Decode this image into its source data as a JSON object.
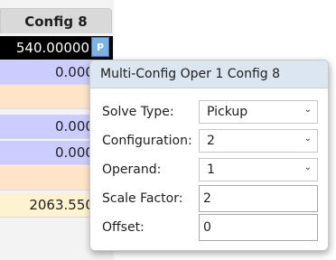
{
  "grid": {
    "column_header": "Config 8",
    "cells": [
      {
        "value": "540.00000",
        "style": "selected"
      },
      {
        "value": "0.00000",
        "style": "lav"
      },
      {
        "value": "",
        "style": "peach"
      },
      {
        "value": "0.00000",
        "style": "lav"
      },
      {
        "value": "0.00000",
        "style": "lav"
      },
      {
        "value": "",
        "style": "peach"
      },
      {
        "value": "2063.55000",
        "style": "yellow"
      }
    ],
    "p_button": "P"
  },
  "popup": {
    "title": "Multi-Config Oper 1 Config 8",
    "solve_type": {
      "label": "Solve Type:",
      "value": "Pickup"
    },
    "configuration": {
      "label": "Configuration:",
      "value": "2"
    },
    "operand": {
      "label": "Operand:",
      "value": "1"
    },
    "scale_factor": {
      "label": "Scale Factor:",
      "value": "2"
    },
    "offset": {
      "label": "Offset:",
      "value": "0"
    }
  },
  "icons": {
    "dropdown": "chevron-down-icon"
  }
}
